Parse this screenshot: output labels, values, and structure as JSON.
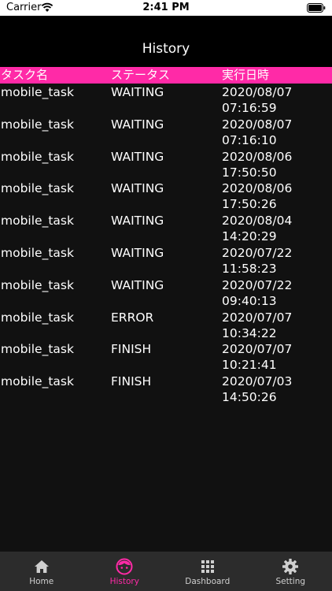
{
  "status_bar": {
    "carrier": "Carrier",
    "time": "2:41 PM"
  },
  "nav": {
    "title": "History"
  },
  "table": {
    "columns": [
      "タスク名",
      "ステータス",
      "実行日時"
    ],
    "rows": [
      {
        "task": "mobile_task",
        "status": "WAITING",
        "date": "2020/08/07",
        "time": "07:16:59"
      },
      {
        "task": "mobile_task",
        "status": "WAITING",
        "date": "2020/08/07",
        "time": "07:16:10"
      },
      {
        "task": "mobile_task",
        "status": "WAITING",
        "date": "2020/08/06",
        "time": "17:50:50"
      },
      {
        "task": "mobile_task",
        "status": "WAITING",
        "date": "2020/08/06",
        "time": "17:50:26"
      },
      {
        "task": "mobile_task",
        "status": "WAITING",
        "date": "2020/08/04",
        "time": "14:20:29"
      },
      {
        "task": "mobile_task",
        "status": "WAITING",
        "date": "2020/07/22",
        "time": "11:58:23"
      },
      {
        "task": "mobile_task",
        "status": "WAITING",
        "date": "2020/07/22",
        "time": "09:40:13"
      },
      {
        "task": "mobile_task",
        "status": "ERROR",
        "date": "2020/07/07",
        "time": "10:34:22"
      },
      {
        "task": "mobile_task",
        "status": "FINISH",
        "date": "2020/07/07",
        "time": "10:21:41"
      },
      {
        "task": "mobile_task",
        "status": "FINISH",
        "date": "2020/07/03",
        "time": "14:50:26"
      }
    ]
  },
  "tabbar": {
    "tabs": [
      {
        "label": "Home",
        "icon": "home-icon"
      },
      {
        "label": "History",
        "icon": "face-icon"
      },
      {
        "label": "Dashboard",
        "icon": "grid-icon"
      },
      {
        "label": "Setting",
        "icon": "gear-icon"
      }
    ],
    "active": "History"
  },
  "colors": {
    "accent": "#ff2aa7",
    "background": "#111111",
    "tabbar": "#2c2c2c"
  }
}
